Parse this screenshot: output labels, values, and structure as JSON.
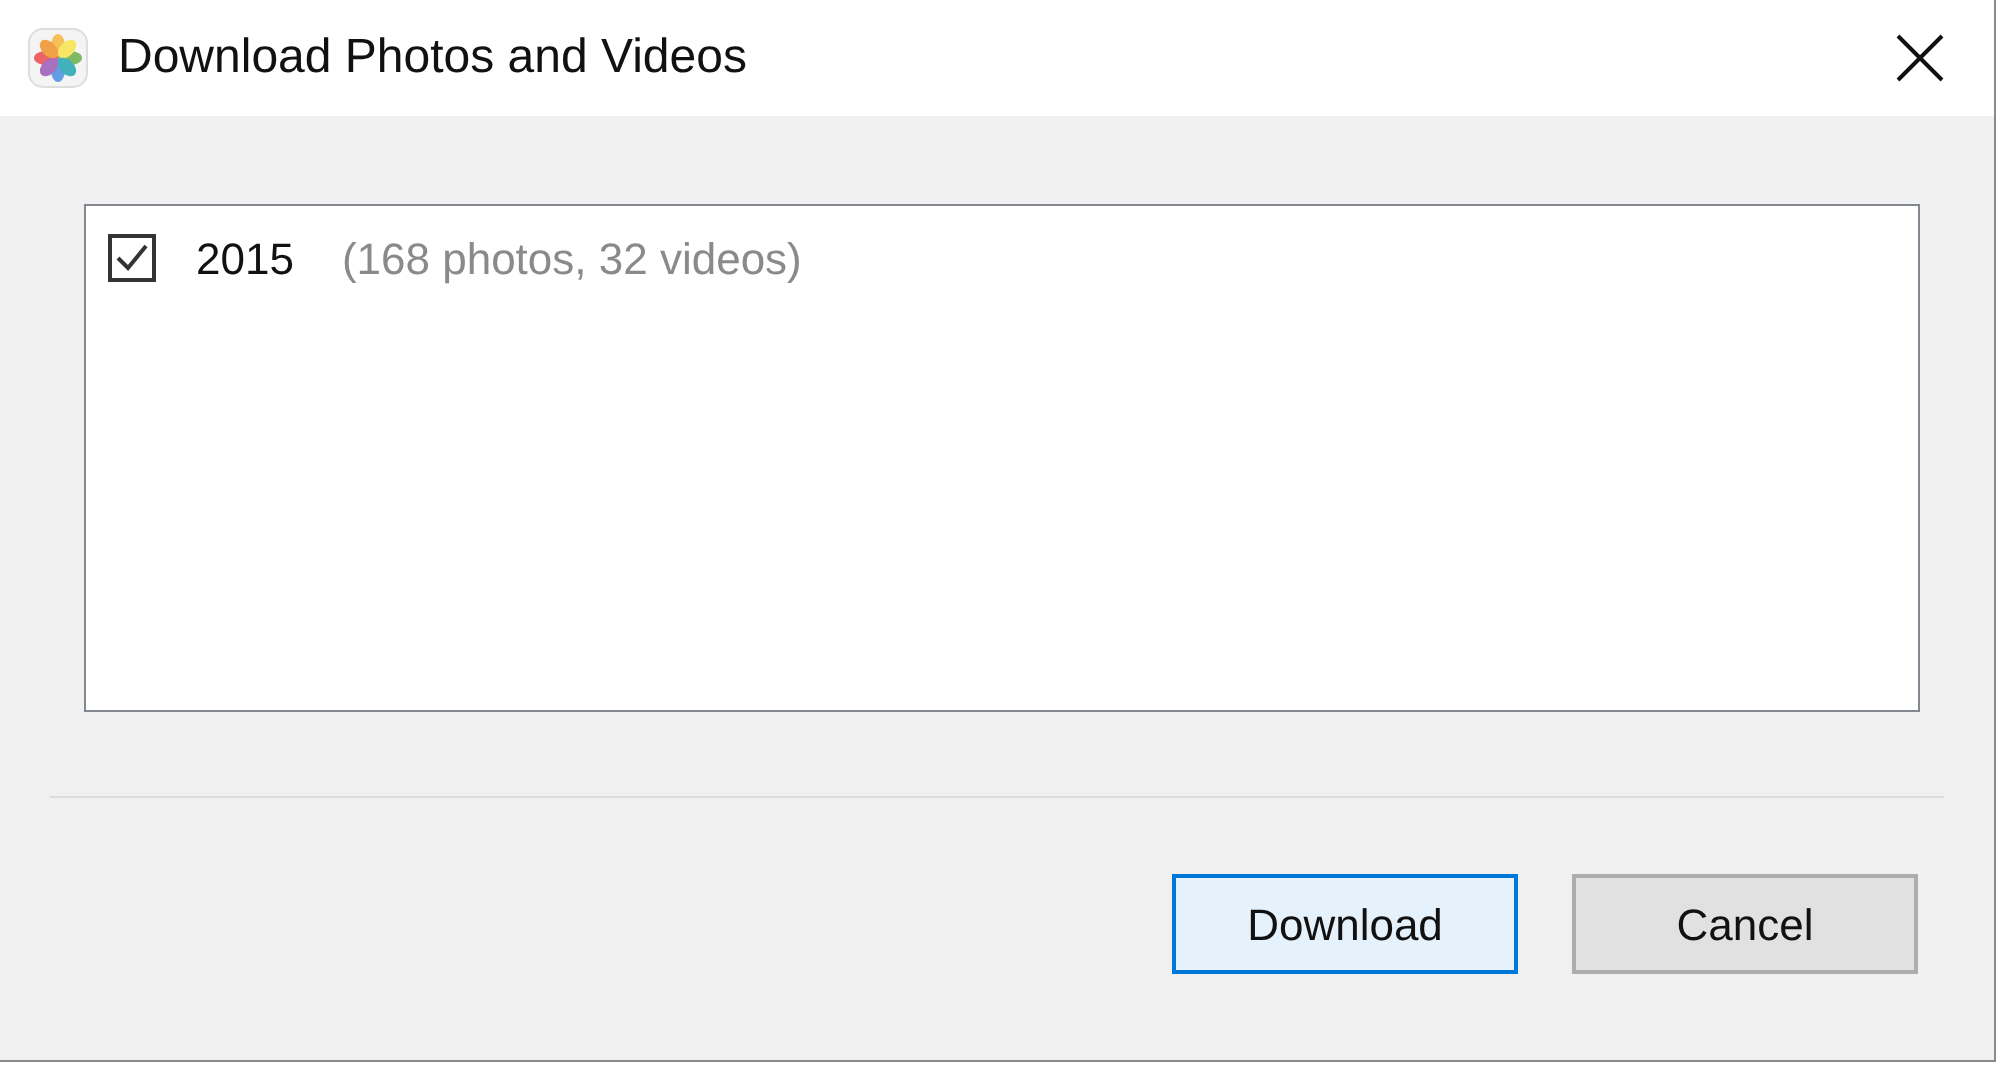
{
  "window": {
    "title": "Download Photos and Videos"
  },
  "folders": [
    {
      "name": "2015",
      "detail": "(168 photos, 32 videos)",
      "checked": true
    }
  ],
  "buttons": [
    {
      "label": "Download",
      "focused": true
    },
    {
      "label": "Cancel",
      "focused": false
    }
  ]
}
